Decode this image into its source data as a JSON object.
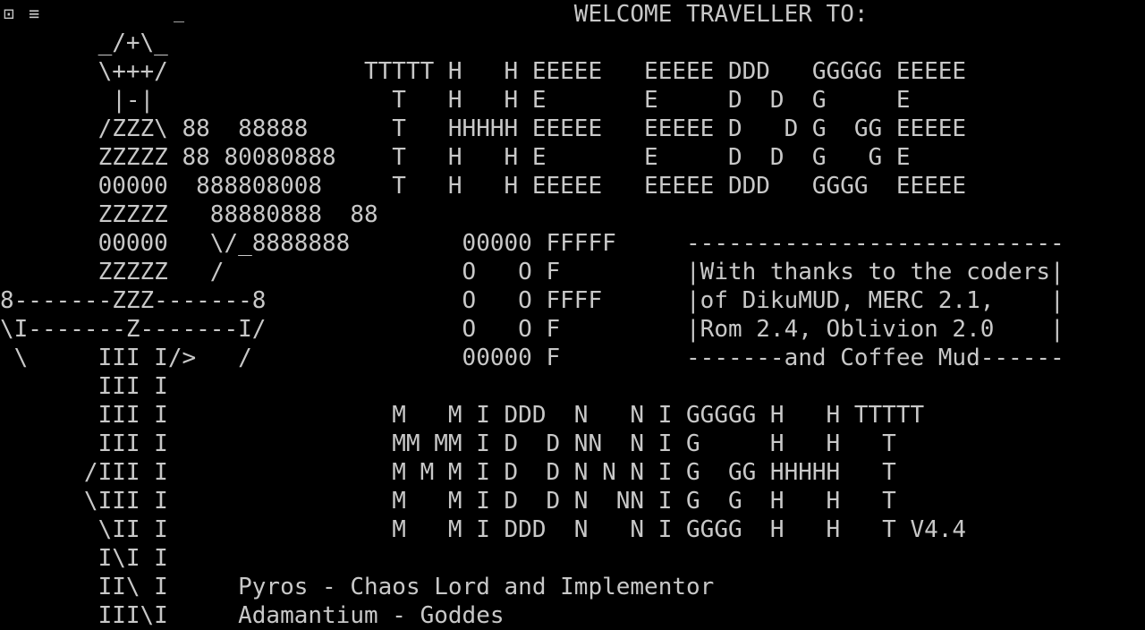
{
  "terminal": {
    "colors": {
      "background": "#000000",
      "foreground": "#c8c8c8"
    },
    "icons": {
      "window_menu": "window-menu-icon",
      "hamburger": "hamburger-menu-icon"
    },
    "lines": [
      "                                         WELCOME TRAVELLER TO:",
      "       _/+\\_",
      "       \\+++/              TTTTT H   H EEEEE   EEEEE DDD   GGGGG EEEEE",
      "        |-|                 T   H   H E       E     D  D  G     E",
      "       /ZZZ\\ 88  88888      T   HHHHH EEEEE   EEEEE D   D G  GG EEEEE",
      "       ZZZZZ 88 80080888    T   H   H E       E     D  D  G   G E",
      "       00000  888808008     T   H   H EEEEE   EEEEE DDD   GGGG  EEEEE",
      "       ZZZZZ   88880888  88",
      "       00000   \\/_8888888        00000 FFFFF     ---------------------------",
      "       ZZZZZ   /                 O   O F         |With thanks to the coders|",
      "8-------ZZZ-------8              O   O FFFF      |of DikuMUD, MERC 2.1,    |",
      "\\I-------Z-------I/              O   O F         |Rom 2.4, Oblivion 2.0    |",
      " \\     III I/>   /               00000 F         -------and Coffee Mud------",
      "       III I",
      "       III I                M   M I DDD  N   N I GGGGG H   H TTTTT",
      "       III I                MM MM I D  D NN  N I G     H   H   T",
      "      /III I                M M M I D  D N N N I G  GG HHHHH   T",
      "      \\III I                M   M I D  D N  NN I G  G  H   H   T",
      "       \\II I                M   M I DDD  N   N I GGGG  H   H   T V4.4",
      "       I\\I I",
      "       II\\ I     Pyros - Chaos Lord and Implementor",
      "       III\\I     Adamantium - Goddes"
    ]
  }
}
